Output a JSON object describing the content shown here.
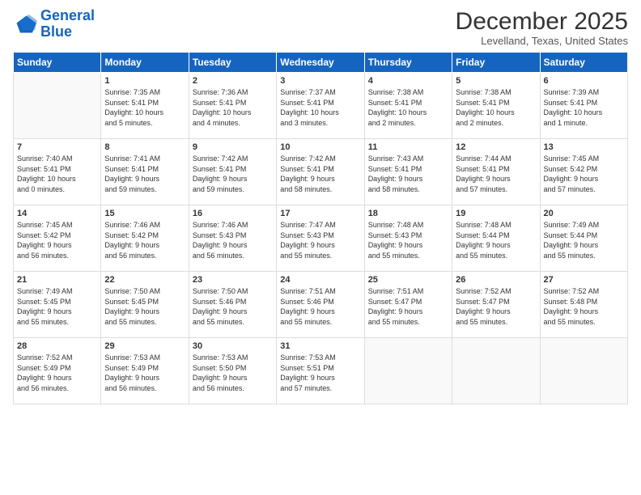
{
  "logo": {
    "line1": "General",
    "line2": "Blue"
  },
  "title": "December 2025",
  "subtitle": "Levelland, Texas, United States",
  "days_header": [
    "Sunday",
    "Monday",
    "Tuesday",
    "Wednesday",
    "Thursday",
    "Friday",
    "Saturday"
  ],
  "weeks": [
    [
      {
        "day": "",
        "text": ""
      },
      {
        "day": "1",
        "text": "Sunrise: 7:35 AM\nSunset: 5:41 PM\nDaylight: 10 hours\nand 5 minutes."
      },
      {
        "day": "2",
        "text": "Sunrise: 7:36 AM\nSunset: 5:41 PM\nDaylight: 10 hours\nand 4 minutes."
      },
      {
        "day": "3",
        "text": "Sunrise: 7:37 AM\nSunset: 5:41 PM\nDaylight: 10 hours\nand 3 minutes."
      },
      {
        "day": "4",
        "text": "Sunrise: 7:38 AM\nSunset: 5:41 PM\nDaylight: 10 hours\nand 2 minutes."
      },
      {
        "day": "5",
        "text": "Sunrise: 7:38 AM\nSunset: 5:41 PM\nDaylight: 10 hours\nand 2 minutes."
      },
      {
        "day": "6",
        "text": "Sunrise: 7:39 AM\nSunset: 5:41 PM\nDaylight: 10 hours\nand 1 minute."
      }
    ],
    [
      {
        "day": "7",
        "text": "Sunrise: 7:40 AM\nSunset: 5:41 PM\nDaylight: 10 hours\nand 0 minutes."
      },
      {
        "day": "8",
        "text": "Sunrise: 7:41 AM\nSunset: 5:41 PM\nDaylight: 9 hours\nand 59 minutes."
      },
      {
        "day": "9",
        "text": "Sunrise: 7:42 AM\nSunset: 5:41 PM\nDaylight: 9 hours\nand 59 minutes."
      },
      {
        "day": "10",
        "text": "Sunrise: 7:42 AM\nSunset: 5:41 PM\nDaylight: 9 hours\nand 58 minutes."
      },
      {
        "day": "11",
        "text": "Sunrise: 7:43 AM\nSunset: 5:41 PM\nDaylight: 9 hours\nand 58 minutes."
      },
      {
        "day": "12",
        "text": "Sunrise: 7:44 AM\nSunset: 5:41 PM\nDaylight: 9 hours\nand 57 minutes."
      },
      {
        "day": "13",
        "text": "Sunrise: 7:45 AM\nSunset: 5:42 PM\nDaylight: 9 hours\nand 57 minutes."
      }
    ],
    [
      {
        "day": "14",
        "text": "Sunrise: 7:45 AM\nSunset: 5:42 PM\nDaylight: 9 hours\nand 56 minutes."
      },
      {
        "day": "15",
        "text": "Sunrise: 7:46 AM\nSunset: 5:42 PM\nDaylight: 9 hours\nand 56 minutes."
      },
      {
        "day": "16",
        "text": "Sunrise: 7:46 AM\nSunset: 5:43 PM\nDaylight: 9 hours\nand 56 minutes."
      },
      {
        "day": "17",
        "text": "Sunrise: 7:47 AM\nSunset: 5:43 PM\nDaylight: 9 hours\nand 55 minutes."
      },
      {
        "day": "18",
        "text": "Sunrise: 7:48 AM\nSunset: 5:43 PM\nDaylight: 9 hours\nand 55 minutes."
      },
      {
        "day": "19",
        "text": "Sunrise: 7:48 AM\nSunset: 5:44 PM\nDaylight: 9 hours\nand 55 minutes."
      },
      {
        "day": "20",
        "text": "Sunrise: 7:49 AM\nSunset: 5:44 PM\nDaylight: 9 hours\nand 55 minutes."
      }
    ],
    [
      {
        "day": "21",
        "text": "Sunrise: 7:49 AM\nSunset: 5:45 PM\nDaylight: 9 hours\nand 55 minutes."
      },
      {
        "day": "22",
        "text": "Sunrise: 7:50 AM\nSunset: 5:45 PM\nDaylight: 9 hours\nand 55 minutes."
      },
      {
        "day": "23",
        "text": "Sunrise: 7:50 AM\nSunset: 5:46 PM\nDaylight: 9 hours\nand 55 minutes."
      },
      {
        "day": "24",
        "text": "Sunrise: 7:51 AM\nSunset: 5:46 PM\nDaylight: 9 hours\nand 55 minutes."
      },
      {
        "day": "25",
        "text": "Sunrise: 7:51 AM\nSunset: 5:47 PM\nDaylight: 9 hours\nand 55 minutes."
      },
      {
        "day": "26",
        "text": "Sunrise: 7:52 AM\nSunset: 5:47 PM\nDaylight: 9 hours\nand 55 minutes."
      },
      {
        "day": "27",
        "text": "Sunrise: 7:52 AM\nSunset: 5:48 PM\nDaylight: 9 hours\nand 55 minutes."
      }
    ],
    [
      {
        "day": "28",
        "text": "Sunrise: 7:52 AM\nSunset: 5:49 PM\nDaylight: 9 hours\nand 56 minutes."
      },
      {
        "day": "29",
        "text": "Sunrise: 7:53 AM\nSunset: 5:49 PM\nDaylight: 9 hours\nand 56 minutes."
      },
      {
        "day": "30",
        "text": "Sunrise: 7:53 AM\nSunset: 5:50 PM\nDaylight: 9 hours\nand 56 minutes."
      },
      {
        "day": "31",
        "text": "Sunrise: 7:53 AM\nSunset: 5:51 PM\nDaylight: 9 hours\nand 57 minutes."
      },
      {
        "day": "",
        "text": ""
      },
      {
        "day": "",
        "text": ""
      },
      {
        "day": "",
        "text": ""
      }
    ]
  ]
}
